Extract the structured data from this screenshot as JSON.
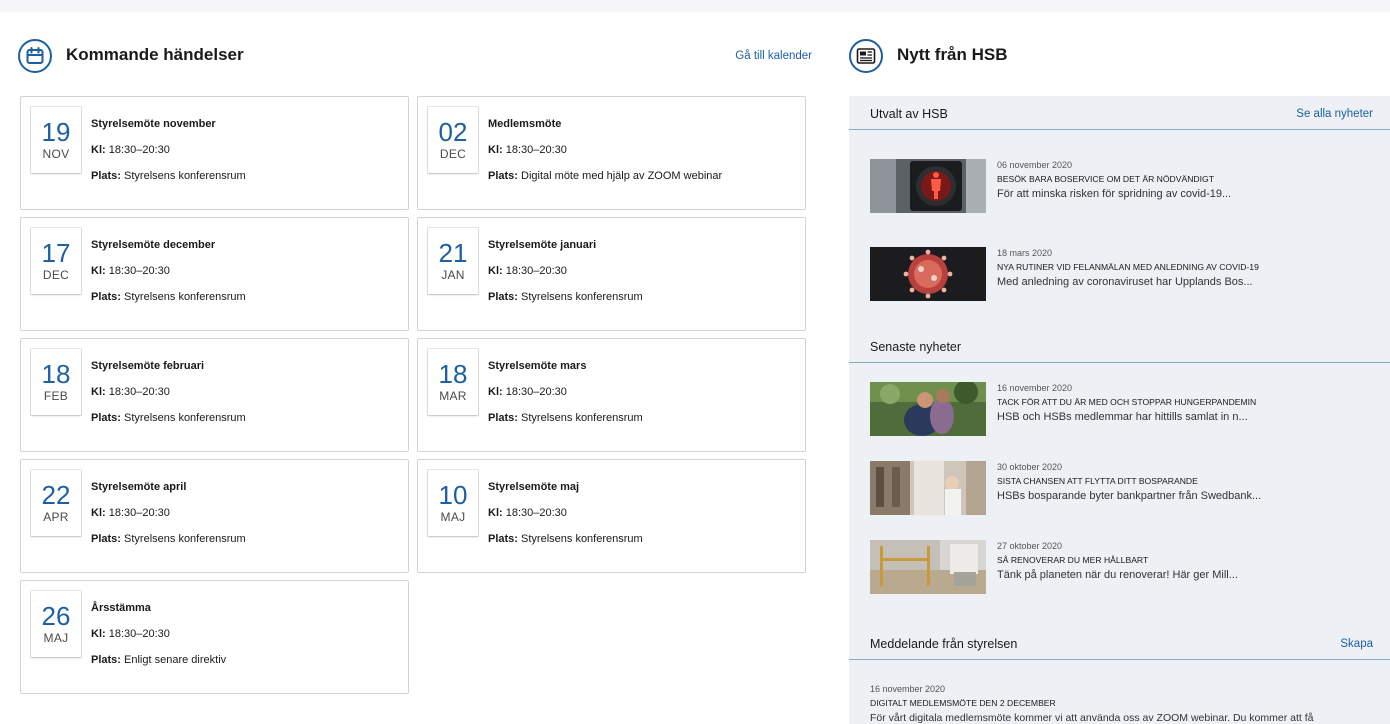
{
  "events": {
    "title": "Kommande händelser",
    "link": "Gå till kalender",
    "time_label": "Kl:",
    "place_label": "Plats:",
    "items": [
      {
        "day": "19",
        "month": "NOV",
        "title": "Styrelsemöte november",
        "time": "18:30–20:30",
        "place": "Styrelsens konferensrum"
      },
      {
        "day": "02",
        "month": "DEC",
        "title": "Medlemsmöte",
        "time": "18:30–20:30",
        "place": "Digital möte med hjälp av ZOOM webinar"
      },
      {
        "day": "17",
        "month": "DEC",
        "title": "Styrelsemöte december",
        "time": "18:30–20:30",
        "place": "Styrelsens konferensrum"
      },
      {
        "day": "21",
        "month": "JAN",
        "title": "Styrelsemöte januari",
        "time": "18:30–20:30",
        "place": "Styrelsens konferensrum"
      },
      {
        "day": "18",
        "month": "FEB",
        "title": "Styrelsemöte februari",
        "time": "18:30–20:30",
        "place": "Styrelsens konferensrum"
      },
      {
        "day": "18",
        "month": "MAR",
        "title": "Styrelsemöte mars",
        "time": "18:30–20:30",
        "place": "Styrelsens konferensrum"
      },
      {
        "day": "22",
        "month": "APR",
        "title": "Styrelsemöte april",
        "time": "18:30–20:30",
        "place": "Styrelsens konferensrum"
      },
      {
        "day": "10",
        "month": "MAJ",
        "title": "Styrelsemöte maj",
        "time": "18:30–20:30",
        "place": "Styrelsens konferensrum"
      },
      {
        "day": "26",
        "month": "MAJ",
        "title": "Årsstämma",
        "time": "18:30–20:30",
        "place": "Enligt senare direktiv"
      }
    ]
  },
  "news": {
    "title": "Nytt från HSB",
    "selected": {
      "heading": "Utvalt av HSB",
      "link": "Se alla nyheter",
      "items": [
        {
          "date": "06 november 2020",
          "title": "BESÖK BARA BOSERVICE OM DET ÄR NÖDVÄNDIGT",
          "excerpt": "För att minska risken för spridning av covid-19..."
        },
        {
          "date": "18 mars 2020",
          "title": "NYA RUTINER VID FELANMÄLAN MED ANLEDNING AV COVID-19",
          "excerpt": "Med anledning av coronaviruset har Upplands Bos..."
        }
      ]
    },
    "latest": {
      "heading": "Senaste nyheter",
      "items": [
        {
          "date": "16 november 2020",
          "title": "TACK FÖR ATT DU ÄR MED OCH STOPPAR HUNGERPANDEMIN",
          "excerpt": "HSB och HSBs medlemmar har hittills samlat in n..."
        },
        {
          "date": "30 oktober 2020",
          "title": "SISTA CHANSEN ATT FLYTTA DITT BOSPARANDE",
          "excerpt": "HSBs bosparande byter bankpartner från Swedbank..."
        },
        {
          "date": "27 oktober 2020",
          "title": "SÅ RENOVERAR DU MER HÅLLBART",
          "excerpt": "Tänk på planeten när du renoverar! Här ger Mill..."
        }
      ]
    },
    "board": {
      "heading": "Meddelande från styrelsen",
      "link": "Skapa",
      "message": {
        "date": "16 november 2020",
        "title": "DIGITALT MEDLEMSMÖTE DEN 2 DECEMBER",
        "excerpt": "För vårt digitala medlemsmöte kommer vi att använda oss av ZOOM webinar. Du kommer att få"
      }
    }
  },
  "colors": {
    "accent": "#1d5fa3",
    "panel_bg": "#edf0f4",
    "divider": "#8aa9c9",
    "card_border": "#cfd4da"
  }
}
